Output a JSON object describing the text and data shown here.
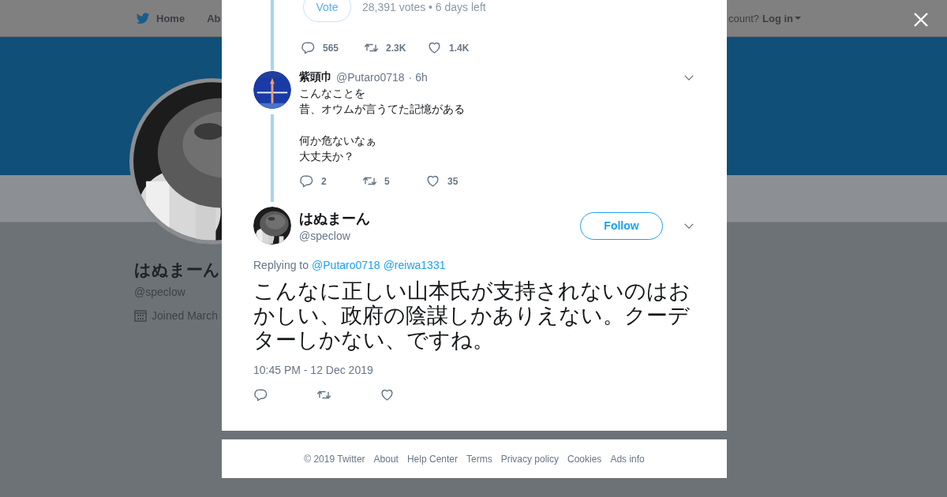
{
  "background_page": {
    "nav": {
      "items": [
        {
          "label": "Home",
          "kind": "bird"
        },
        {
          "label": "Ab",
          "kind": "plain"
        }
      ],
      "account_prompt": "count?",
      "login": "Log in"
    },
    "profile": {
      "name": "はぬまーん",
      "handle": "@speclow",
      "joined": "Joined March"
    }
  },
  "modal": {
    "poll": {
      "vote_button": "Vote",
      "disabled": true,
      "summary": "28,391 votes • 6 days left"
    },
    "poll_stats": [
      {
        "kind": "reply",
        "count": "565"
      },
      {
        "kind": "retweet",
        "count": "2.3K"
      },
      {
        "kind": "like",
        "count": "1.4K"
      }
    ],
    "reply": {
      "name": "紫頭巾",
      "handle": "@Putaro0718",
      "time": "· 6h",
      "paragraphs": [
        [
          "こんなことを",
          "昔、オウムが言うてた記憶がある"
        ],
        [
          "何か危ないなぁ",
          "大丈夫か？"
        ]
      ],
      "stats": [
        {
          "kind": "reply",
          "count": "2"
        },
        {
          "kind": "retweet",
          "count": "5"
        },
        {
          "kind": "like",
          "count": "35"
        }
      ]
    },
    "main_tweet": {
      "name": "はぬまーん",
      "handle": "@speclow",
      "follow_button": "Follow",
      "replying_label": "Replying to",
      "mentions": [
        "@Putaro0718",
        "@reiwa1331"
      ],
      "text": "こんなに正しい山本氏が支持されないのはおかしい、政府の陰謀しかありえない。クーデターしかない、ですね。",
      "timestamp": "10:45 PM - 12 Dec 2019",
      "actions": [
        {
          "kind": "reply"
        },
        {
          "kind": "retweet"
        },
        {
          "kind": "like"
        }
      ]
    }
  },
  "footer": [
    "© 2019 Twitter",
    "About",
    "Help Center",
    "Terms",
    "Privacy policy",
    "Cookies",
    "Ads info"
  ]
}
